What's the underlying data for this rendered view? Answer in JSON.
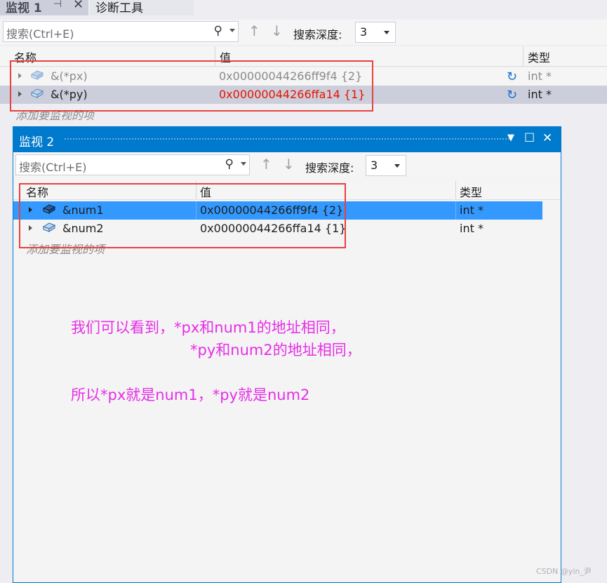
{
  "watch1": {
    "tab_title": "监视 1",
    "pin_icon": "pin-icon",
    "close_icon": "close-icon",
    "other_tab": "诊断工具",
    "search_placeholder": "搜索(Ctrl+E)",
    "search_depth_label": "搜索深度:",
    "search_depth_value": "3",
    "columns": {
      "name": "名称",
      "value": "值",
      "type": "类型"
    },
    "rows": [
      {
        "name": "&(*px)",
        "value": "0x00000044266ff9f4 {2}",
        "type": "int *"
      },
      {
        "name": "&(*py)",
        "value": "0x00000044266ffa14 {1}",
        "type": "int *"
      }
    ],
    "add_item_placeholder": "添加要监视的项"
  },
  "watch2": {
    "title": "监视 2",
    "search_placeholder": "搜索(Ctrl+E)",
    "search_depth_label": "搜索深度:",
    "search_depth_value": "3",
    "columns": {
      "name": "名称",
      "value": "值",
      "type": "类型"
    },
    "rows": [
      {
        "name": "&num1",
        "value": "0x00000044266ff9f4 {2}",
        "type": "int *"
      },
      {
        "name": "&num2",
        "value": "0x00000044266ffa14 {1}",
        "type": "int *"
      }
    ],
    "add_item_placeholder": "添加要监视的项"
  },
  "annotation": {
    "line1": "我们可以看到，*px和num1的地址相同，",
    "line2": "*py和num2的地址相同，",
    "line3": "所以*px就是num1，*py就是num2"
  },
  "watermark": "CSDN @yin_尹",
  "colors": {
    "accent": "#007acc",
    "selection": "#3399ff",
    "changed_value": "#e51400",
    "annotation": "#e62ee6",
    "highlight_box": "#e8413d"
  }
}
